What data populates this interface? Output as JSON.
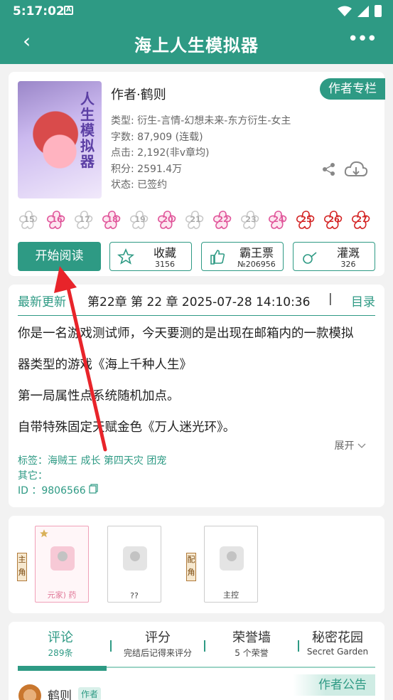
{
  "status": {
    "time": "5:17:02",
    "badge": "A"
  },
  "appbar": {
    "title": "海上人生模拟器",
    "back_glyph": "‹",
    "more_glyph": "•••"
  },
  "book": {
    "author": "作者·鹤则",
    "author_column": "作者专栏",
    "cover_text": [
      "人",
      "生",
      "模",
      "拟",
      "器"
    ],
    "meta": {
      "type": "类型: 衍生-言情-幻想未来-东方衍生-女主",
      "words": "字数: 87,909 (连载)",
      "clicks": "点击: 2,192(非v章均)",
      "score": "积分: 2591.4万",
      "state": "状态: 已签约"
    }
  },
  "flowers": [
    {
      "n": "15",
      "on": false
    },
    {
      "n": "16",
      "on": true
    },
    {
      "n": "17",
      "on": false
    },
    {
      "n": "18",
      "on": true
    },
    {
      "n": "19",
      "on": false
    },
    {
      "n": "20",
      "on": true
    },
    {
      "n": "21",
      "on": false
    },
    {
      "n": "22",
      "on": true
    },
    {
      "n": "23",
      "on": false
    },
    {
      "n": "24",
      "on": true
    },
    {
      "n": "25",
      "on": "red"
    },
    {
      "n": "26",
      "on": "red"
    },
    {
      "n": "27",
      "on": "red"
    }
  ],
  "actions": {
    "read": "开始阅读",
    "collect": {
      "label": "收藏",
      "count": "3156"
    },
    "ticket": {
      "label": "霸王票",
      "count": "№206956"
    },
    "water": {
      "label": "灌溉",
      "count": "326"
    }
  },
  "update": {
    "label": "最新更新",
    "chapter": "第22章  第 22 章  2025-07-28 14:10:36",
    "separator": "|",
    "toc": "目录"
  },
  "intro": [
    "你是一名游戏测试师，今天要测的是出现在邮箱内的一款模拟",
    "器类型的游戏《海上千种人生》",
    "第一局属性点系统随机加点。",
    "自带特殊固定天赋金色《万人迷光环》。"
  ],
  "expand": "展开",
  "tags": {
    "tags": "标签：海贼王 成长 第四天灾 团宠",
    "other": "其它：",
    "id": "ID   ：9806566"
  },
  "roles": {
    "main_tag": "主角",
    "support_tag": "配角",
    "role1_caption": "元家)    药",
    "role2_caption": "??",
    "role3_caption": "主控"
  },
  "tabs": [
    {
      "title": "评论",
      "sub": "289条"
    },
    {
      "title": "评分",
      "sub": "完结后记得来评分"
    },
    {
      "title": "荣誉墙",
      "sub": "5 个荣誉"
    },
    {
      "title": "秘密花园",
      "sub": "Secret Garden"
    }
  ],
  "notice": "作者公告",
  "comment": {
    "name": "鹤则",
    "badge": "作者"
  },
  "colors": {
    "primary": "#2e9a84",
    "flower_pink": "#e0559a",
    "flower_red": "#d42424",
    "arrow": "#e8242a"
  }
}
